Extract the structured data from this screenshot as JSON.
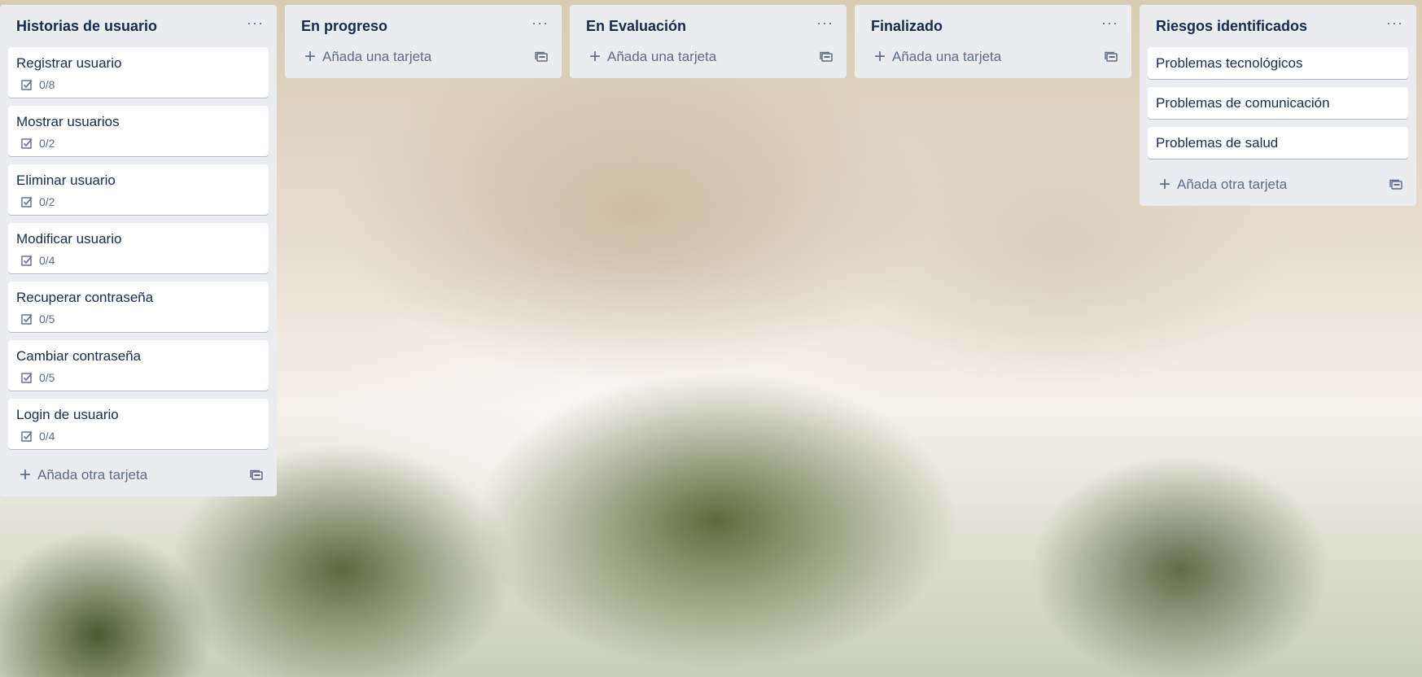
{
  "lists": [
    {
      "title": "Historias de usuario",
      "menu": "···",
      "cards": [
        {
          "title": "Registrar usuario",
          "checklist": "0/8"
        },
        {
          "title": "Mostrar usuarios",
          "checklist": "0/2"
        },
        {
          "title": "Eliminar usuario",
          "checklist": "0/2"
        },
        {
          "title": "Modificar usuario",
          "checklist": "0/4"
        },
        {
          "title": "Recuperar contraseña",
          "checklist": "0/5"
        },
        {
          "title": "Cambiar contraseña",
          "checklist": "0/5"
        },
        {
          "title": "Login de usuario",
          "checklist": "0/4"
        }
      ],
      "add_label": "Añada otra tarjeta"
    },
    {
      "title": "En progreso",
      "menu": "···",
      "cards": [],
      "add_label": "Añada una tarjeta"
    },
    {
      "title": "En Evaluación",
      "menu": "···",
      "cards": [],
      "add_label": "Añada una tarjeta"
    },
    {
      "title": "Finalizado",
      "menu": "···",
      "cards": [],
      "add_label": "Añada una tarjeta"
    },
    {
      "title": "Riesgos identificados",
      "menu": "···",
      "cards": [
        {
          "title": "Problemas tecnológicos"
        },
        {
          "title": "Problemas de comunicación"
        },
        {
          "title": "Problemas de salud"
        }
      ],
      "add_label": "Añada otra tarjeta"
    }
  ],
  "icons": {
    "plus": "+",
    "checklist": "checklist-icon",
    "template": "card-template-icon"
  },
  "colors": {
    "list_bg": "#ebecf0",
    "card_bg": "#ffffff",
    "title_text": "#172b4d",
    "muted_text": "#5e6c84"
  }
}
